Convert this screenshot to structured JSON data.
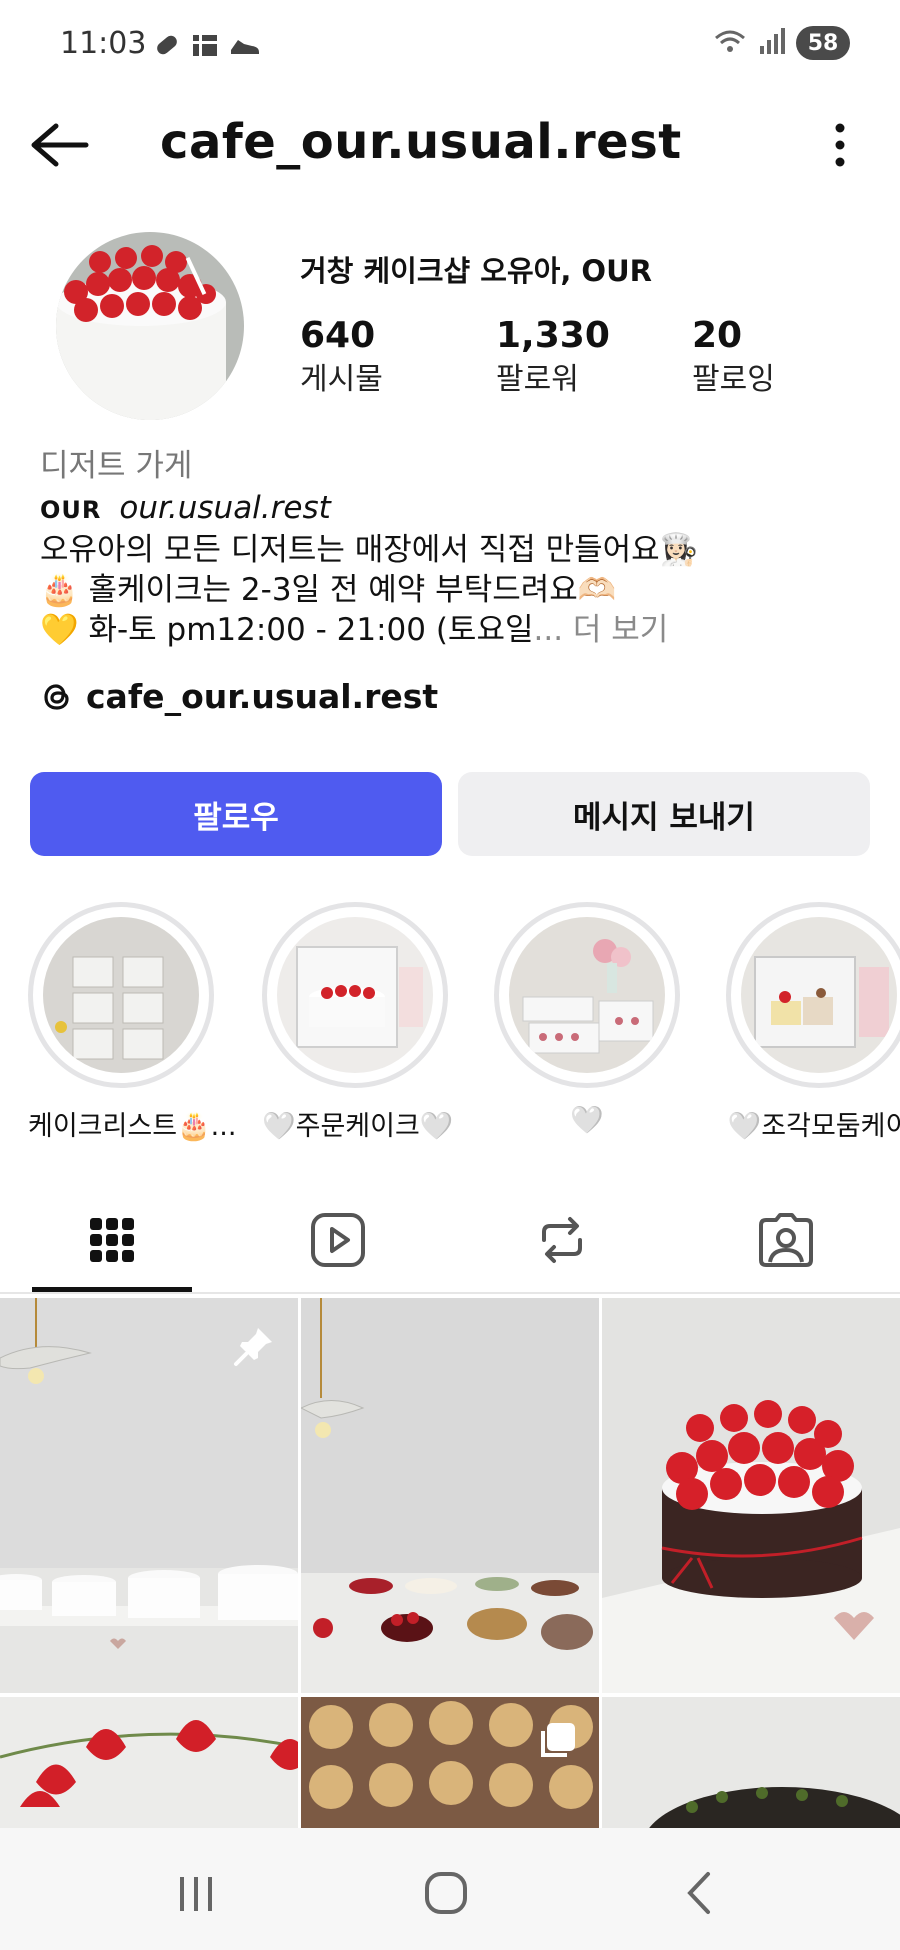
{
  "status_bar": {
    "time": "11:03",
    "battery": "58"
  },
  "header": {
    "username": "cafe_our.usual.rest"
  },
  "profile": {
    "display_name": "거창 케이크샵 오유아, OUR",
    "stats": [
      {
        "value": "640",
        "label": "게시물"
      },
      {
        "value": "1,330",
        "label": "팔로워"
      },
      {
        "value": "20",
        "label": "팔로잉"
      }
    ],
    "category": "디저트 가게",
    "bio": {
      "brand": "OUR",
      "handle": "our.usual.rest",
      "line2": "오유아의 모든 디저트는 매장에서 직접 만들어요👩🏻‍🍳",
      "line3": "🎂 홀케이크는 2-3일 전 예약 부탁드려요🫶🏻",
      "line4": "💛 화-토 pm12:00 - 21:00 (토요일",
      "more": "... 더 보기"
    },
    "threads_link": "cafe_our.usual.rest"
  },
  "actions": {
    "follow": "팔로우",
    "message": "메시지 보내기"
  },
  "highlights": [
    {
      "label": "케이크리스트🎂..."
    },
    {
      "label": "🤍주문케이크🤍"
    },
    {
      "label": "🤍"
    },
    {
      "label": "🤍조각모둠케이"
    }
  ],
  "tabs": [
    {
      "name": "grid-tab",
      "icon": "grid-icon"
    },
    {
      "name": "reels-tab",
      "icon": "reels-icon"
    },
    {
      "name": "reposts-tab",
      "icon": "repost-icon"
    },
    {
      "name": "tagged-tab",
      "icon": "tagged-person-icon"
    }
  ],
  "colors": {
    "follow_button": "#4f5bf0",
    "message_button": "#efeff1",
    "secondary_text": "#777777"
  }
}
